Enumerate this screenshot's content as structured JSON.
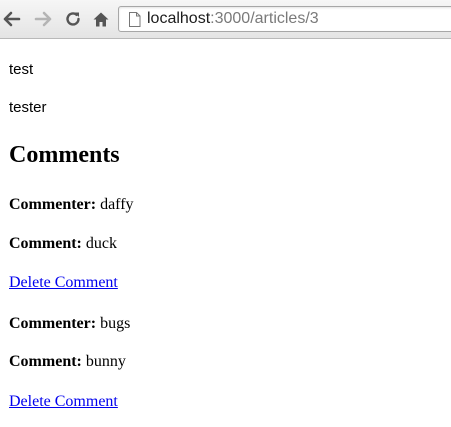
{
  "browser": {
    "url_host": "localhost",
    "url_path": ":3000/articles/3",
    "icons": {
      "back": "back-arrow-icon",
      "forward": "forward-arrow-icon",
      "reload": "reload-icon",
      "home": "home-icon",
      "page": "page-icon"
    }
  },
  "article": {
    "title": "test",
    "text": "tester"
  },
  "comments_heading": "Comments",
  "comments": [
    {
      "commenter_label": "Commenter:",
      "commenter": "daffy",
      "comment_label": "Comment:",
      "body": "duck",
      "delete_label": "Delete Comment"
    },
    {
      "commenter_label": "Commenter:",
      "commenter": "bugs",
      "comment_label": "Comment:",
      "body": "bunny",
      "delete_label": "Delete Comment"
    }
  ],
  "colors": {
    "link": "#0000ee",
    "url_path": "#7a7a7a"
  }
}
